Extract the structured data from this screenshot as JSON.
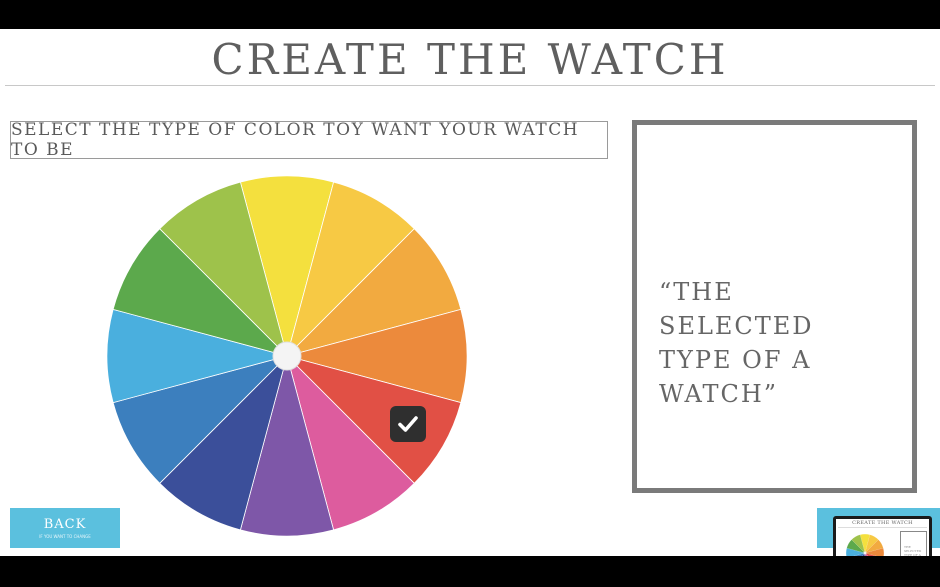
{
  "header": {
    "title": "CREATE THE WATCH"
  },
  "prompt": {
    "text": "SELECT THE TYPE OF COLOR TOY WANT YOUR WATCH TO BE"
  },
  "color_wheel": {
    "segments": [
      {
        "name": "yellow",
        "color": "#f4e03e"
      },
      {
        "name": "yellow-orange",
        "color": "#f7c944"
      },
      {
        "name": "light-orange",
        "color": "#f2aa40"
      },
      {
        "name": "orange",
        "color": "#ec8a3c"
      },
      {
        "name": "red",
        "color": "#e15045",
        "selected": true
      },
      {
        "name": "pink",
        "color": "#dd5c9e"
      },
      {
        "name": "violet",
        "color": "#7e57a8"
      },
      {
        "name": "indigo",
        "color": "#3b4f9a"
      },
      {
        "name": "blue",
        "color": "#3c7fbe"
      },
      {
        "name": "light-blue",
        "color": "#4aafde"
      },
      {
        "name": "green",
        "color": "#5ca94c"
      },
      {
        "name": "yellow-green",
        "color": "#9ec24b"
      }
    ],
    "selected_icon": "checkmark-icon"
  },
  "preview": {
    "text": "“THE SELECTED TYPE OF A WATCH”"
  },
  "nav": {
    "back_label": "BACK",
    "back_subtext": "IF YOU WANT TO CHANGE",
    "accent": "#5bc0de"
  },
  "thumbnail": {
    "title": "CREATE THE WATCH",
    "text": "THE SELECTED TYPE OF A WATCH"
  }
}
